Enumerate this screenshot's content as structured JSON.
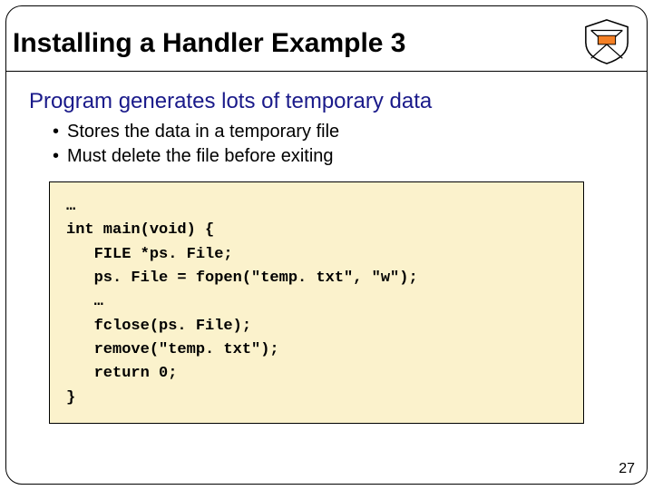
{
  "title": "Installing a Handler Example 3",
  "lead": "Program generates lots of temporary data",
  "bullets": [
    "Stores the data in a temporary file",
    "Must delete the file before exiting"
  ],
  "code": "…\nint main(void) {\n   FILE *ps. File;\n   ps. File = fopen(\"temp. txt\", \"w\");\n   …\n   fclose(ps. File);\n   remove(\"temp. txt\");\n   return 0;\n}",
  "page_number": "27",
  "logo_alt": "Princeton shield"
}
